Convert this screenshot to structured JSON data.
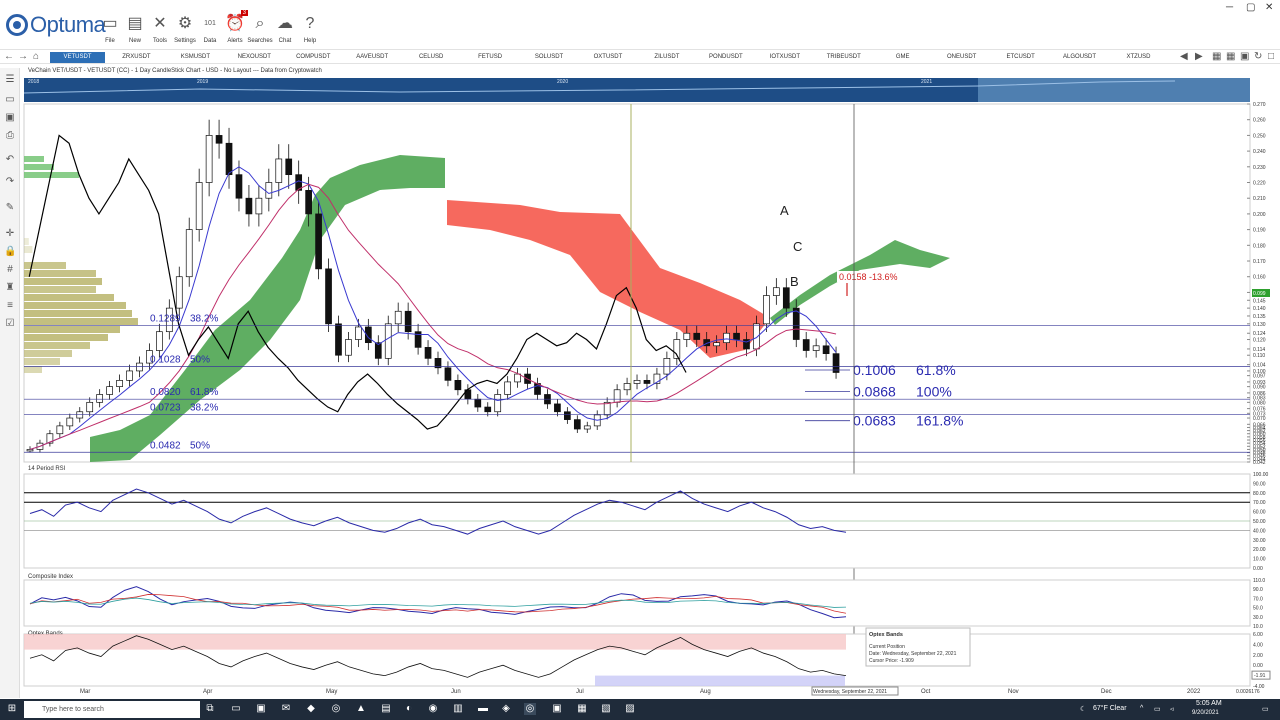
{
  "app": {
    "logo": "Optuma"
  },
  "toolbar": [
    {
      "label": "File",
      "icon": "folder-icon"
    },
    {
      "label": "New",
      "icon": "new-page-icon"
    },
    {
      "label": "Tools",
      "icon": "tools-icon"
    },
    {
      "label": "Settings",
      "icon": "gear-icon"
    },
    {
      "label": "Data",
      "icon": "data-icon"
    },
    {
      "label": "Alerts",
      "icon": "alarm-clock-icon",
      "badge": "3"
    },
    {
      "label": "Searches",
      "icon": "search-icon"
    },
    {
      "label": "Chat",
      "icon": "chat-icon"
    },
    {
      "label": "Help",
      "icon": "help-icon"
    }
  ],
  "tabs": [
    "VETUSDT",
    "ZRXUSDT",
    "KSMUSDT",
    "NEXOUSDT",
    "COMPUSDT",
    "AAVEUSDT",
    "CELUSD",
    "FETUSD",
    "SOLUSDT",
    "OXTUSDT",
    "ZILUSDT",
    "PONDUSDT",
    "IOTXUSDT",
    "TRIBEUSDT",
    "GME",
    "ONEUSDT",
    "ETCUSDT",
    "ALGOUSDT",
    "XTZUSD"
  ],
  "header": {
    "title": "VeChain VET/USDT - VETUSDT (CC) - 1 Day CandleStick Chart - USD - No Layout --- Data from Cryptowatch"
  },
  "colors": {
    "accent": "#2d6fb6",
    "cloud_bull": "#43a047",
    "cloud_bear": "#f44336",
    "fib_text": "#2a2ab0",
    "overview": "#1e4d86"
  },
  "chart_data": {
    "type": "candlestick",
    "symbol": "VETUSDT",
    "x_labels": [
      "Mar",
      "Apr",
      "May",
      "Jun",
      "Jul",
      "Aug",
      "Oct",
      "Nov",
      "Dec",
      "2022"
    ],
    "overview_labels": [
      "2018",
      "2019",
      "2020",
      "2021"
    ],
    "y_ticks": [
      "0.270",
      "0.260",
      "0.250",
      "0.240",
      "0.230",
      "0.220",
      "0.210",
      "0.200",
      "0.190",
      "0.180",
      "0.170",
      "0.160",
      "0.150",
      "0.145",
      "0.140",
      "0.135",
      "0.130",
      "0.124",
      "0.120",
      "0.114",
      "0.110",
      "0.104",
      "0.100",
      "0.097",
      "0.093",
      "0.090",
      "0.086",
      "0.083",
      "0.080",
      "0.076",
      "0.073",
      "0.070",
      "0.066",
      "0.064",
      "0.062",
      "0.060",
      "0.058",
      "0.056",
      "0.054",
      "0.052",
      "0.050",
      "0.048",
      "0.046",
      "0.044",
      "0.042"
    ],
    "last_price_tag": "0.099",
    "close": [
      0.05,
      0.054,
      0.06,
      0.065,
      0.07,
      0.074,
      0.08,
      0.085,
      0.09,
      0.094,
      0.1,
      0.105,
      0.113,
      0.125,
      0.14,
      0.16,
      0.19,
      0.22,
      0.25,
      0.245,
      0.225,
      0.21,
      0.2,
      0.21,
      0.22,
      0.235,
      0.225,
      0.215,
      0.2,
      0.165,
      0.13,
      0.11,
      0.12,
      0.128,
      0.118,
      0.108,
      0.13,
      0.138,
      0.125,
      0.115,
      0.108,
      0.102,
      0.094,
      0.088,
      0.082,
      0.077,
      0.074,
      0.085,
      0.093,
      0.098,
      0.092,
      0.085,
      0.079,
      0.074,
      0.069,
      0.063,
      0.065,
      0.072,
      0.08,
      0.088,
      0.092,
      0.094,
      0.092,
      0.098,
      0.108,
      0.12,
      0.124,
      0.12,
      0.116,
      0.118,
      0.124,
      0.12,
      0.114,
      0.13,
      0.148,
      0.153,
      0.14,
      0.12,
      0.113,
      0.116,
      0.111,
      0.099
    ],
    "fib_levels": [
      {
        "value": "0.1289",
        "pct": "38.2%"
      },
      {
        "value": "0.1028",
        "pct": "50%"
      },
      {
        "value": "0.0820",
        "pct": "61.8%"
      },
      {
        "value": "0.0723",
        "pct": "38.2%"
      },
      {
        "value": "0.0482",
        "pct": "50%"
      }
    ],
    "fib_projections": [
      {
        "value": "0.1006",
        "pct": "61.8%"
      },
      {
        "value": "0.0868",
        "pct": "100%"
      },
      {
        "value": "0.0683",
        "pct": "161.8%"
      }
    ],
    "change_label": "0.0158  -13.6%",
    "wave_labels": [
      "A",
      "B",
      "C"
    ],
    "rsi": {
      "title": "14 Period RSI",
      "ticks": [
        "100.00",
        "90.00",
        "80.00",
        "70.00",
        "60.00",
        "50.00",
        "40.00",
        "30.00",
        "20.00",
        "10.00",
        "0.00"
      ],
      "values": [
        58,
        62,
        55,
        67,
        70,
        64,
        60,
        72,
        78,
        84,
        80,
        74,
        68,
        72,
        66,
        60,
        52,
        48,
        55,
        60,
        64,
        58,
        52,
        48,
        45,
        50,
        54,
        48,
        44,
        40,
        38,
        42,
        48,
        52,
        46,
        44,
        40,
        36,
        42,
        46,
        50,
        44,
        40,
        36,
        40,
        48,
        56,
        62,
        68,
        72,
        70,
        66,
        62,
        70,
        76,
        82,
        74,
        68,
        64,
        60,
        66,
        70,
        64,
        60,
        54,
        46,
        42,
        44,
        40,
        38
      ]
    },
    "composite": {
      "title": "Composite Index",
      "ticks": [
        "110.0",
        "90.0",
        "70.0",
        "50.0",
        "30.0",
        "10.0"
      ]
    },
    "optex": {
      "title": "Optex Bands",
      "ticks": [
        "6.00",
        "4.00",
        "2.00",
        "0.00",
        "-2.00",
        "-4.00"
      ],
      "cursor_value": "-1.91"
    },
    "x_axis_extra": {
      "cursor_date": "Wednesday, September 22, 2021",
      "scale": "0.0026176"
    }
  },
  "tooltip": {
    "title": "Optex Bands",
    "l1": "Current Position",
    "l2": "Date: Wednesday, September 22, 2021",
    "l3": "Cursor Price: -1.909"
  },
  "taskbar": {
    "search_placeholder": "Type here to search",
    "weather": "67°F  Clear",
    "time": "5:05 AM",
    "date": "9/20/2021"
  }
}
